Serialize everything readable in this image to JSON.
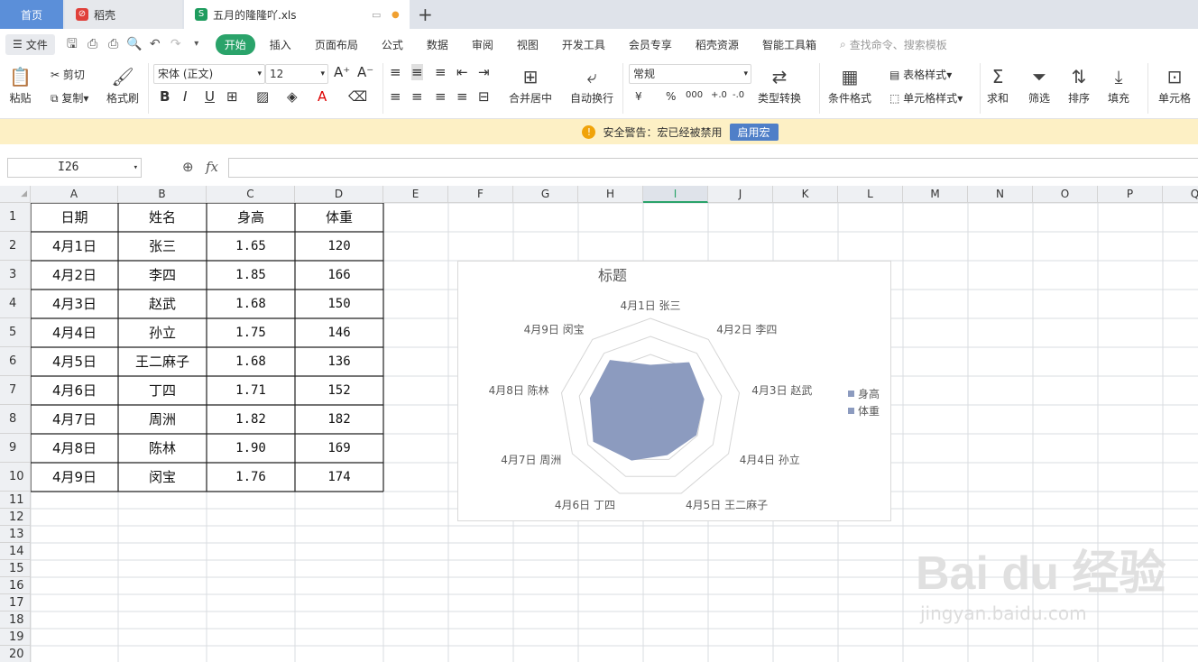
{
  "tabs": {
    "home": "首页",
    "doc1": "稻壳",
    "doc2": "五月的隆隆吖.xls",
    "new_tab": "+"
  },
  "menu": {
    "file": "文件",
    "start": "开始",
    "items": [
      "插入",
      "页面布局",
      "公式",
      "数据",
      "审阅",
      "视图",
      "开发工具",
      "会员专享",
      "稻壳资源",
      "智能工具箱"
    ],
    "search": "查找命令、搜索模板"
  },
  "ribbon": {
    "paste": "粘贴",
    "cut": "剪切",
    "copy": "复制",
    "format_painter": "格式刷",
    "font": "宋体 (正文)",
    "font_size": "12",
    "number_format": "常规",
    "merge_center": "合并居中",
    "wrap_text": "自动换行",
    "type_convert": "类型转换",
    "cond_format": "条件格式",
    "table_style": "表格样式",
    "cell_style": "单元格样式",
    "sum": "求和",
    "filter": "筛选",
    "sort": "排序",
    "fill": "填充",
    "cell": "单元格",
    "currency": "¥",
    "percent": "%",
    "thousand": "000",
    "inc_dec": "+.0",
    "dec_dec": "-.0"
  },
  "warning": {
    "text": "安全警告：宏已经被禁用",
    "button": "启用宏"
  },
  "formula": {
    "namebox": "I26",
    "fx": "fx",
    "value": ""
  },
  "columns": [
    "A",
    "B",
    "C",
    "D",
    "E",
    "F",
    "G",
    "H",
    "I",
    "J",
    "K",
    "L",
    "M",
    "N",
    "O",
    "P",
    "Q"
  ],
  "rows": [
    "1",
    "2",
    "3",
    "4",
    "5",
    "6",
    "7",
    "8",
    "9",
    "10",
    "11",
    "12",
    "13",
    "14",
    "15",
    "16",
    "17",
    "18",
    "19",
    "20"
  ],
  "table": {
    "headers": [
      "日期",
      "姓名",
      "身高",
      "体重"
    ],
    "rows": [
      [
        "4月1日",
        "张三",
        "1.65",
        "120"
      ],
      [
        "4月2日",
        "李四",
        "1.85",
        "166"
      ],
      [
        "4月3日",
        "赵武",
        "1.68",
        "150"
      ],
      [
        "4月4日",
        "孙立",
        "1.75",
        "146"
      ],
      [
        "4月5日",
        "王二麻子",
        "1.68",
        "136"
      ],
      [
        "4月6日",
        "丁四",
        "1.71",
        "152"
      ],
      [
        "4月7日",
        "周洲",
        "1.82",
        "182"
      ],
      [
        "4月8日",
        "陈林",
        "1.90",
        "169"
      ],
      [
        "4月9日",
        "闵宝",
        "1.76",
        "174"
      ]
    ]
  },
  "chart_data": {
    "type": "radar",
    "title": "标题",
    "categories": [
      "4月1日 张三",
      "4月2日 李四",
      "4月3日 赵武",
      "4月4日 孙立",
      "4月5日 王二麻子",
      "4月6日 丁四",
      "4月7日 周洲",
      "4月8日 陈林",
      "4月9日 闵宝"
    ],
    "series": [
      {
        "name": "身高",
        "values": [
          1.65,
          1.85,
          1.68,
          1.75,
          1.68,
          1.71,
          1.82,
          1.9,
          1.76
        ]
      },
      {
        "name": "体重",
        "values": [
          120,
          166,
          150,
          146,
          136,
          152,
          182,
          169,
          174
        ]
      }
    ],
    "rmax": 250,
    "legend": "right",
    "colors": {
      "fill": "#8c9bbf",
      "grid": "#d6d6d6",
      "series1": "#8c9bbf",
      "series2": "#8c9bbf"
    }
  },
  "watermark": {
    "main": "Bai du 经验",
    "sub": "jingyan.baidu.com"
  }
}
